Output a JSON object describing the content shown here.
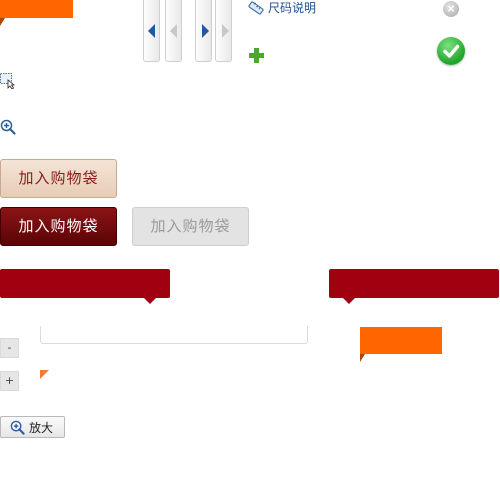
{
  "size_guide": {
    "label": "尺码说明",
    "icon": "ruler-icon"
  },
  "cart_buttons": {
    "light": "加入购物袋",
    "dark": "加入购物袋",
    "disabled": "加入购物袋"
  },
  "quantity": {
    "minus": "-",
    "plus": "+"
  },
  "zoom_button": {
    "label": "放大",
    "icon": "zoom-in-icon"
  },
  "close_icon": {
    "glyph": "×"
  },
  "colors": {
    "orange": "#ff6600",
    "dark_red": "#a00010",
    "link_blue": "#1f4f8c",
    "green": "#4aa92a"
  }
}
